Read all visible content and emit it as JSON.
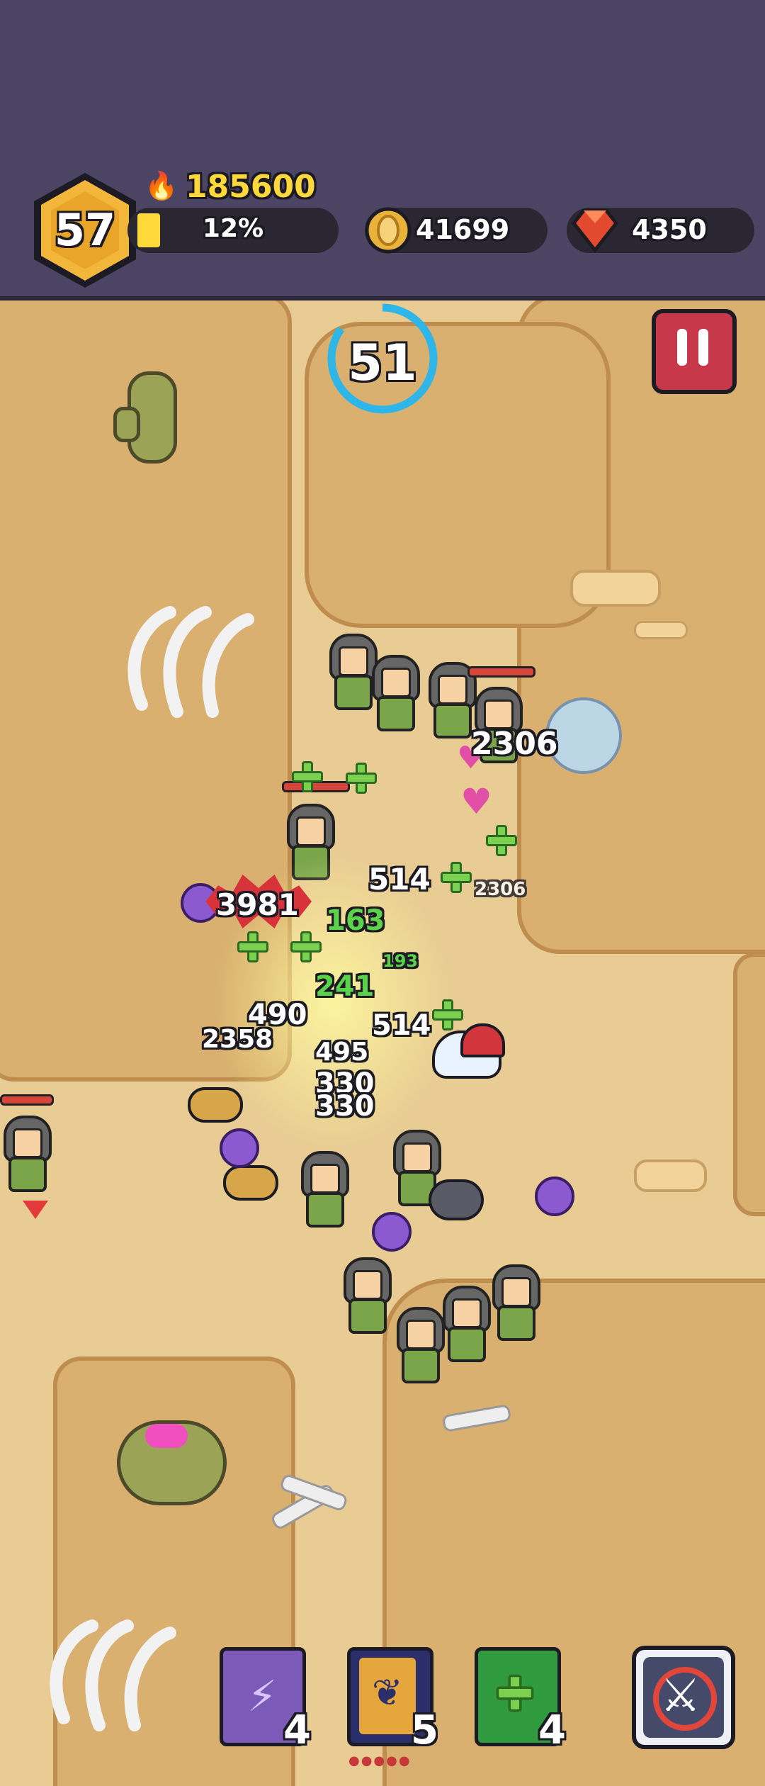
{
  "hud": {
    "level": "57",
    "power": "185600",
    "xp_percent_label": "12%",
    "xp_fraction": 0.12,
    "gold": "41699",
    "gems": "4350"
  },
  "timer": {
    "value": "51",
    "ring_fraction": 0.85
  },
  "pause_button": {
    "icon": "pause-icon"
  },
  "damage_numbers": [
    {
      "text": "2306",
      "color": "white"
    },
    {
      "text": "3981",
      "color": "white"
    },
    {
      "text": "514",
      "color": "white"
    },
    {
      "text": "2306",
      "color": "white"
    },
    {
      "text": "163",
      "color": "green"
    },
    {
      "text": "193",
      "color": "green"
    },
    {
      "text": "241",
      "color": "green"
    },
    {
      "text": "490",
      "color": "white"
    },
    {
      "text": "2358",
      "color": "white"
    },
    {
      "text": "495",
      "color": "white"
    },
    {
      "text": "514",
      "color": "white"
    },
    {
      "text": "330",
      "color": "white"
    },
    {
      "text": "330",
      "color": "white"
    }
  ],
  "skill_books": [
    {
      "name": "lightning-book",
      "color": "#7c5bb8",
      "count": "4"
    },
    {
      "name": "wing-book",
      "color": "#2a2f6b",
      "count": "5"
    },
    {
      "name": "heal-book",
      "color": "#2f9a3e",
      "count": "4"
    }
  ],
  "auto_attack_button": {
    "icon": "sword-cancel-icon"
  }
}
